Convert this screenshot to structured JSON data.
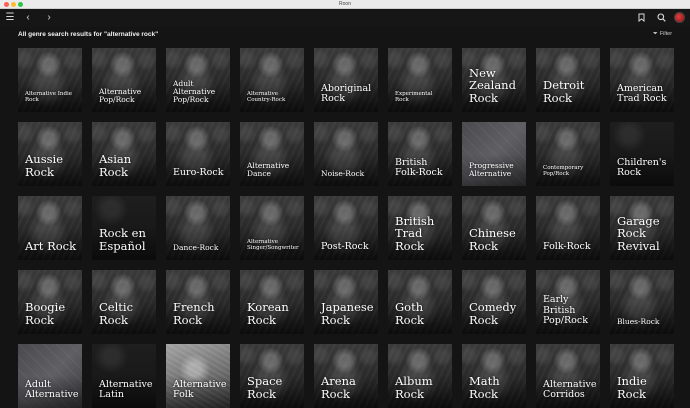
{
  "window": {
    "title": "Roon"
  },
  "toolbar": {
    "menu_icon": "hamburger-icon",
    "back_icon": "chevron-left-icon",
    "forward_icon": "chevron-right-icon",
    "bookmark_icon": "bookmark-icon",
    "search_icon": "search-icon"
  },
  "heading": "All genre search results for \"alternative rock\"",
  "filter_label": "Filter",
  "tiles": [
    {
      "label": "Alternative Indie Rock",
      "size": "xs",
      "style": "photo"
    },
    {
      "label": "Alternative Pop/Rock",
      "size": "sm",
      "style": "photo"
    },
    {
      "label": "Adult Alternative Pop/Rock",
      "size": "sm",
      "style": "photo"
    },
    {
      "label": "Alternative Country-Rock",
      "size": "xs",
      "style": "photo"
    },
    {
      "label": "Aboriginal Rock",
      "size": "md",
      "style": "photo"
    },
    {
      "label": "Experimental Rock",
      "size": "xs",
      "style": "photo"
    },
    {
      "label": "New Zealand Rock",
      "size": "lg",
      "style": "photo"
    },
    {
      "label": "Detroit Rock",
      "size": "lg",
      "style": "photo"
    },
    {
      "label": "American Trad Rock",
      "size": "md",
      "style": "photo"
    },
    {
      "label": "Aussie Rock",
      "size": "lg",
      "style": "photo"
    },
    {
      "label": "Asian Rock",
      "size": "lg",
      "style": "photo"
    },
    {
      "label": "Euro-Rock",
      "size": "md",
      "style": "photo"
    },
    {
      "label": "Alternative Dance",
      "size": "sm",
      "style": "photo"
    },
    {
      "label": "Noise-Rock",
      "size": "sm",
      "style": "photo"
    },
    {
      "label": "British Folk-Rock",
      "size": "md",
      "style": "photo"
    },
    {
      "label": "Progressive Alternative",
      "size": "sm",
      "style": "plain"
    },
    {
      "label": "Contemporary Pop/Rock",
      "size": "xs",
      "style": "photo"
    },
    {
      "label": "Children's Rock",
      "size": "md",
      "style": "dark"
    },
    {
      "label": "Art Rock",
      "size": "lg",
      "style": "photo"
    },
    {
      "label": "Rock en Español",
      "size": "lg",
      "style": "dark"
    },
    {
      "label": "Dance-Rock",
      "size": "sm",
      "style": "photo"
    },
    {
      "label": "Alternative Singer/Songwriter",
      "size": "xs",
      "style": "photo"
    },
    {
      "label": "Post-Rock",
      "size": "md",
      "style": "photo"
    },
    {
      "label": "British Trad Rock",
      "size": "lg",
      "style": "photo"
    },
    {
      "label": "Chinese Rock",
      "size": "lg",
      "style": "photo"
    },
    {
      "label": "Folk-Rock",
      "size": "md",
      "style": "photo"
    },
    {
      "label": "Garage Rock Revival",
      "size": "lg",
      "style": "photo"
    },
    {
      "label": "Boogie Rock",
      "size": "lg",
      "style": "photo"
    },
    {
      "label": "Celtic Rock",
      "size": "lg",
      "style": "photo"
    },
    {
      "label": "French Rock",
      "size": "lg",
      "style": "photo"
    },
    {
      "label": "Korean Rock",
      "size": "lg",
      "style": "photo"
    },
    {
      "label": "Japanese Rock",
      "size": "lg",
      "style": "photo"
    },
    {
      "label": "Goth Rock",
      "size": "lg",
      "style": "photo"
    },
    {
      "label": "Comedy Rock",
      "size": "lg",
      "style": "photo"
    },
    {
      "label": "Early British Pop/Rock",
      "size": "md",
      "style": "photo"
    },
    {
      "label": "Blues-Rock",
      "size": "sm",
      "style": "photo"
    },
    {
      "label": "Adult Alternative",
      "size": "md",
      "style": "plain"
    },
    {
      "label": "Alternative Latin",
      "size": "md",
      "style": "dark"
    },
    {
      "label": "Alternative Folk",
      "size": "md",
      "style": "light"
    },
    {
      "label": "Space Rock",
      "size": "lg",
      "style": "photo"
    },
    {
      "label": "Arena Rock",
      "size": "lg",
      "style": "photo"
    },
    {
      "label": "Album Rock",
      "size": "lg",
      "style": "photo"
    },
    {
      "label": "Math Rock",
      "size": "lg",
      "style": "photo"
    },
    {
      "label": "Alternative Corridos",
      "size": "md",
      "style": "photo"
    },
    {
      "label": "Indie Rock",
      "size": "lg",
      "style": "photo"
    }
  ]
}
